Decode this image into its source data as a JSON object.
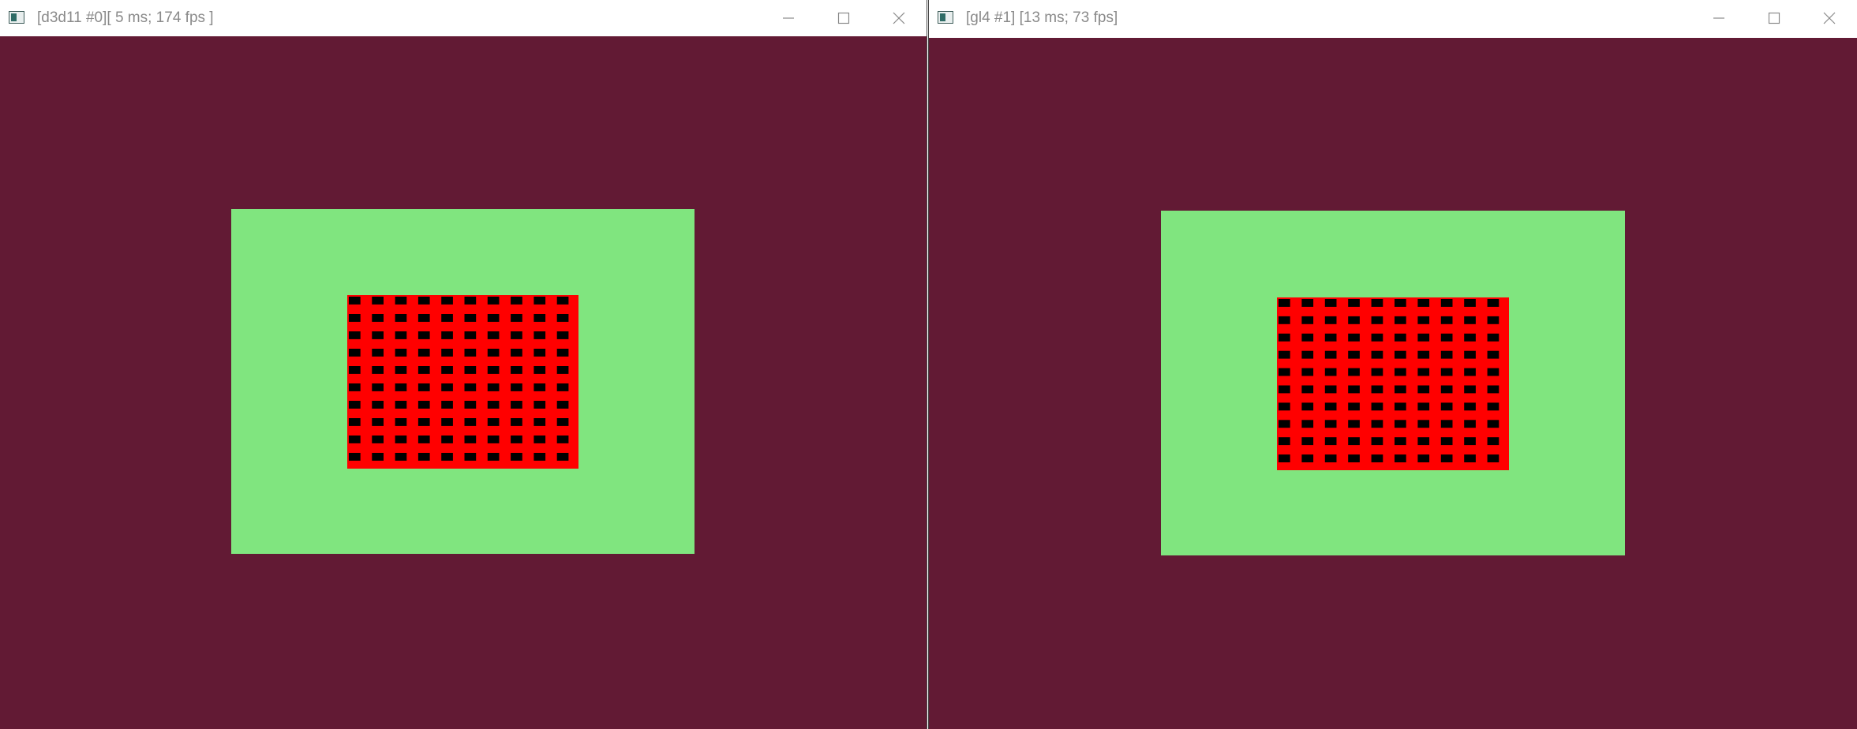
{
  "windows": [
    {
      "title": "[d3d11 #0][ 5 ms; 174 fps ]",
      "controls": {
        "minimize": "minimize-icon",
        "maximize": "maximize-icon",
        "close": "close-icon"
      }
    },
    {
      "title": "[gl4 #1] [13 ms; 73 fps]",
      "controls": {
        "minimize": "minimize-icon",
        "maximize": "maximize-icon",
        "close": "close-icon"
      }
    }
  ],
  "colors": {
    "clear": "#621a34",
    "outer_quad": "#80e57f",
    "inner_quad": "#ff0000",
    "checker": "#000000"
  },
  "checker_grid": {
    "columns": 10,
    "rows": 10
  }
}
